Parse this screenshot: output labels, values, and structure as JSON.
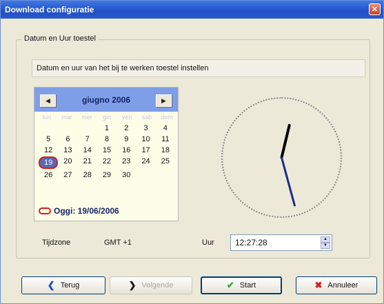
{
  "window": {
    "title": "Download configuratie",
    "close_glyph": "✕"
  },
  "group": {
    "title": "Datum en Uur toestel"
  },
  "description": "Datum en uur van het bij te werken toestel instellen",
  "calendar": {
    "month_label": "giugno 2006",
    "prev_glyph": "◀",
    "next_glyph": "▶",
    "weekdays": [
      "lun",
      "mar",
      "mer",
      "gio",
      "ven",
      "sab",
      "dom"
    ],
    "days": [
      "",
      "",
      "",
      "1",
      "2",
      "3",
      "4",
      "5",
      "6",
      "7",
      "8",
      "9",
      "10",
      "11",
      "12",
      "13",
      "14",
      "15",
      "16",
      "17",
      "18",
      "19",
      "20",
      "21",
      "22",
      "23",
      "24",
      "25",
      "26",
      "27",
      "28",
      "29",
      "30",
      "",
      ""
    ],
    "selected_day": "19",
    "today_text": "Oggi: 19/06/2006"
  },
  "clock": {
    "hour": 12,
    "minute": 27,
    "second": 28
  },
  "timezone": {
    "label": "Tijdzone",
    "value": "GMT +1"
  },
  "time": {
    "label": "Uur",
    "value": "12:27:28"
  },
  "buttons": {
    "back": {
      "label": "Terug",
      "icon": "back-arrow-icon"
    },
    "next": {
      "label": "Volgende",
      "icon": "next-arrow-icon"
    },
    "start": {
      "label": "Start",
      "icon": "check-icon"
    },
    "cancel": {
      "label": "Annuleer",
      "icon": "cancel-x-icon"
    }
  },
  "colors": {
    "titlebar": "#1f4fc4",
    "accent_red": "#d81e1e",
    "start_check": "#3aa336",
    "back_arrow": "#1f4fc4"
  }
}
